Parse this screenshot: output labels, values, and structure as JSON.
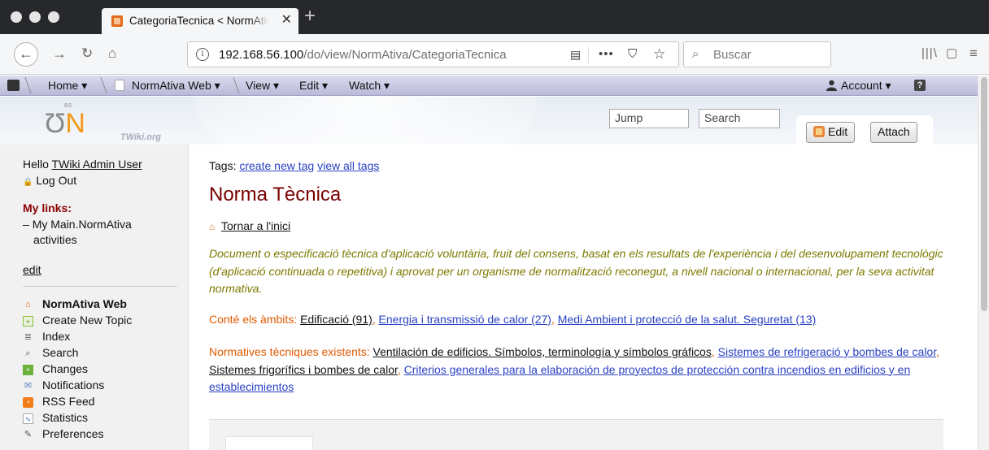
{
  "browser": {
    "tab_title": "CategoriaTecnica < NormAtiva",
    "tab_close": "✕",
    "new_tab": "+",
    "url_host": "192.168.56.100",
    "url_path": "/do/view/NormAtiva/CategoriaTecnica",
    "search_placeholder": "Buscar",
    "icons": [
      "back-icon",
      "forward-icon",
      "reload-icon",
      "home-icon",
      "info-icon",
      "reader-view-icon",
      "page-actions-icon",
      "pocket-icon",
      "bookmark-star-icon",
      "search-icon",
      "library-icon",
      "sidebar-icon",
      "menu-icon"
    ]
  },
  "twiki_toolbar": {
    "home": "Home",
    "web": "NormAtiva Web",
    "view": "View",
    "edit": "Edit",
    "watch": "Watch",
    "account": "Account"
  },
  "header": {
    "logo_es": "es",
    "logo_site": "TWiki.org",
    "jump_placeholder": "Jump",
    "search_placeholder": "Search",
    "edit_button": "Edit",
    "attach_button": "Attach"
  },
  "leftbar": {
    "hello": "Hello",
    "user": "TWiki Admin User",
    "logout": "Log Out",
    "my_links_heading": "My links:",
    "my_link_1": "My Main.NormAtiva",
    "my_link_2": "activities",
    "edit": "edit",
    "web_title": "NormAtiva Web",
    "items": [
      {
        "label": "Create New Topic",
        "icon": "new-topic-icon"
      },
      {
        "label": "Index",
        "icon": "index-icon"
      },
      {
        "label": "Search",
        "icon": "search-icon"
      },
      {
        "label": "Changes",
        "icon": "changes-icon"
      },
      {
        "label": "Notifications",
        "icon": "notifications-icon"
      },
      {
        "label": "RSS Feed",
        "icon": "rss-icon"
      },
      {
        "label": "Statistics",
        "icon": "statistics-icon"
      },
      {
        "label": "Preferences",
        "icon": "preferences-icon"
      }
    ]
  },
  "content": {
    "tags_label": "Tags:",
    "create_tag": "create new tag",
    "view_tags": "view all tags",
    "title": "Norma Tècnica",
    "home_link": "Tornar a l'inici",
    "description": "Document o especificació tècnica d'aplicació voluntària, fruit del consens, basat en els resultats de l'experiència i del desenvolupament tecnològic (d'aplicació continuada o repetitiva) i aprovat per un organisme de normalització reconegut, a nivell nacional o internacional, per la seva activitat normativa.",
    "ambits_label": "Conté els àmbits:",
    "ambits": [
      {
        "text": "Edificació (91)",
        "style": "cat"
      },
      {
        "text": "Energia i transmissió de calor (27)",
        "style": "blue"
      },
      {
        "text": "Medi Ambient i protecció de la salut. Seguretat (13)",
        "style": "blue"
      }
    ],
    "normes_label": "Normatives tècniques existents:",
    "normes": [
      {
        "text": "Ventilación de edificios. Símbolos, terminología y símbolos gráficos",
        "style": "cat"
      },
      {
        "text": "Sistemes de refrigeració y bombes de calor",
        "style": "blue"
      },
      {
        "text": "Sistemes frigorífics i bombes de calor",
        "style": "cat"
      },
      {
        "text": "Criterios generales para la elaboración de proyectos de protección contra incendios en edificios y en establecimientos",
        "style": "blue"
      }
    ]
  }
}
